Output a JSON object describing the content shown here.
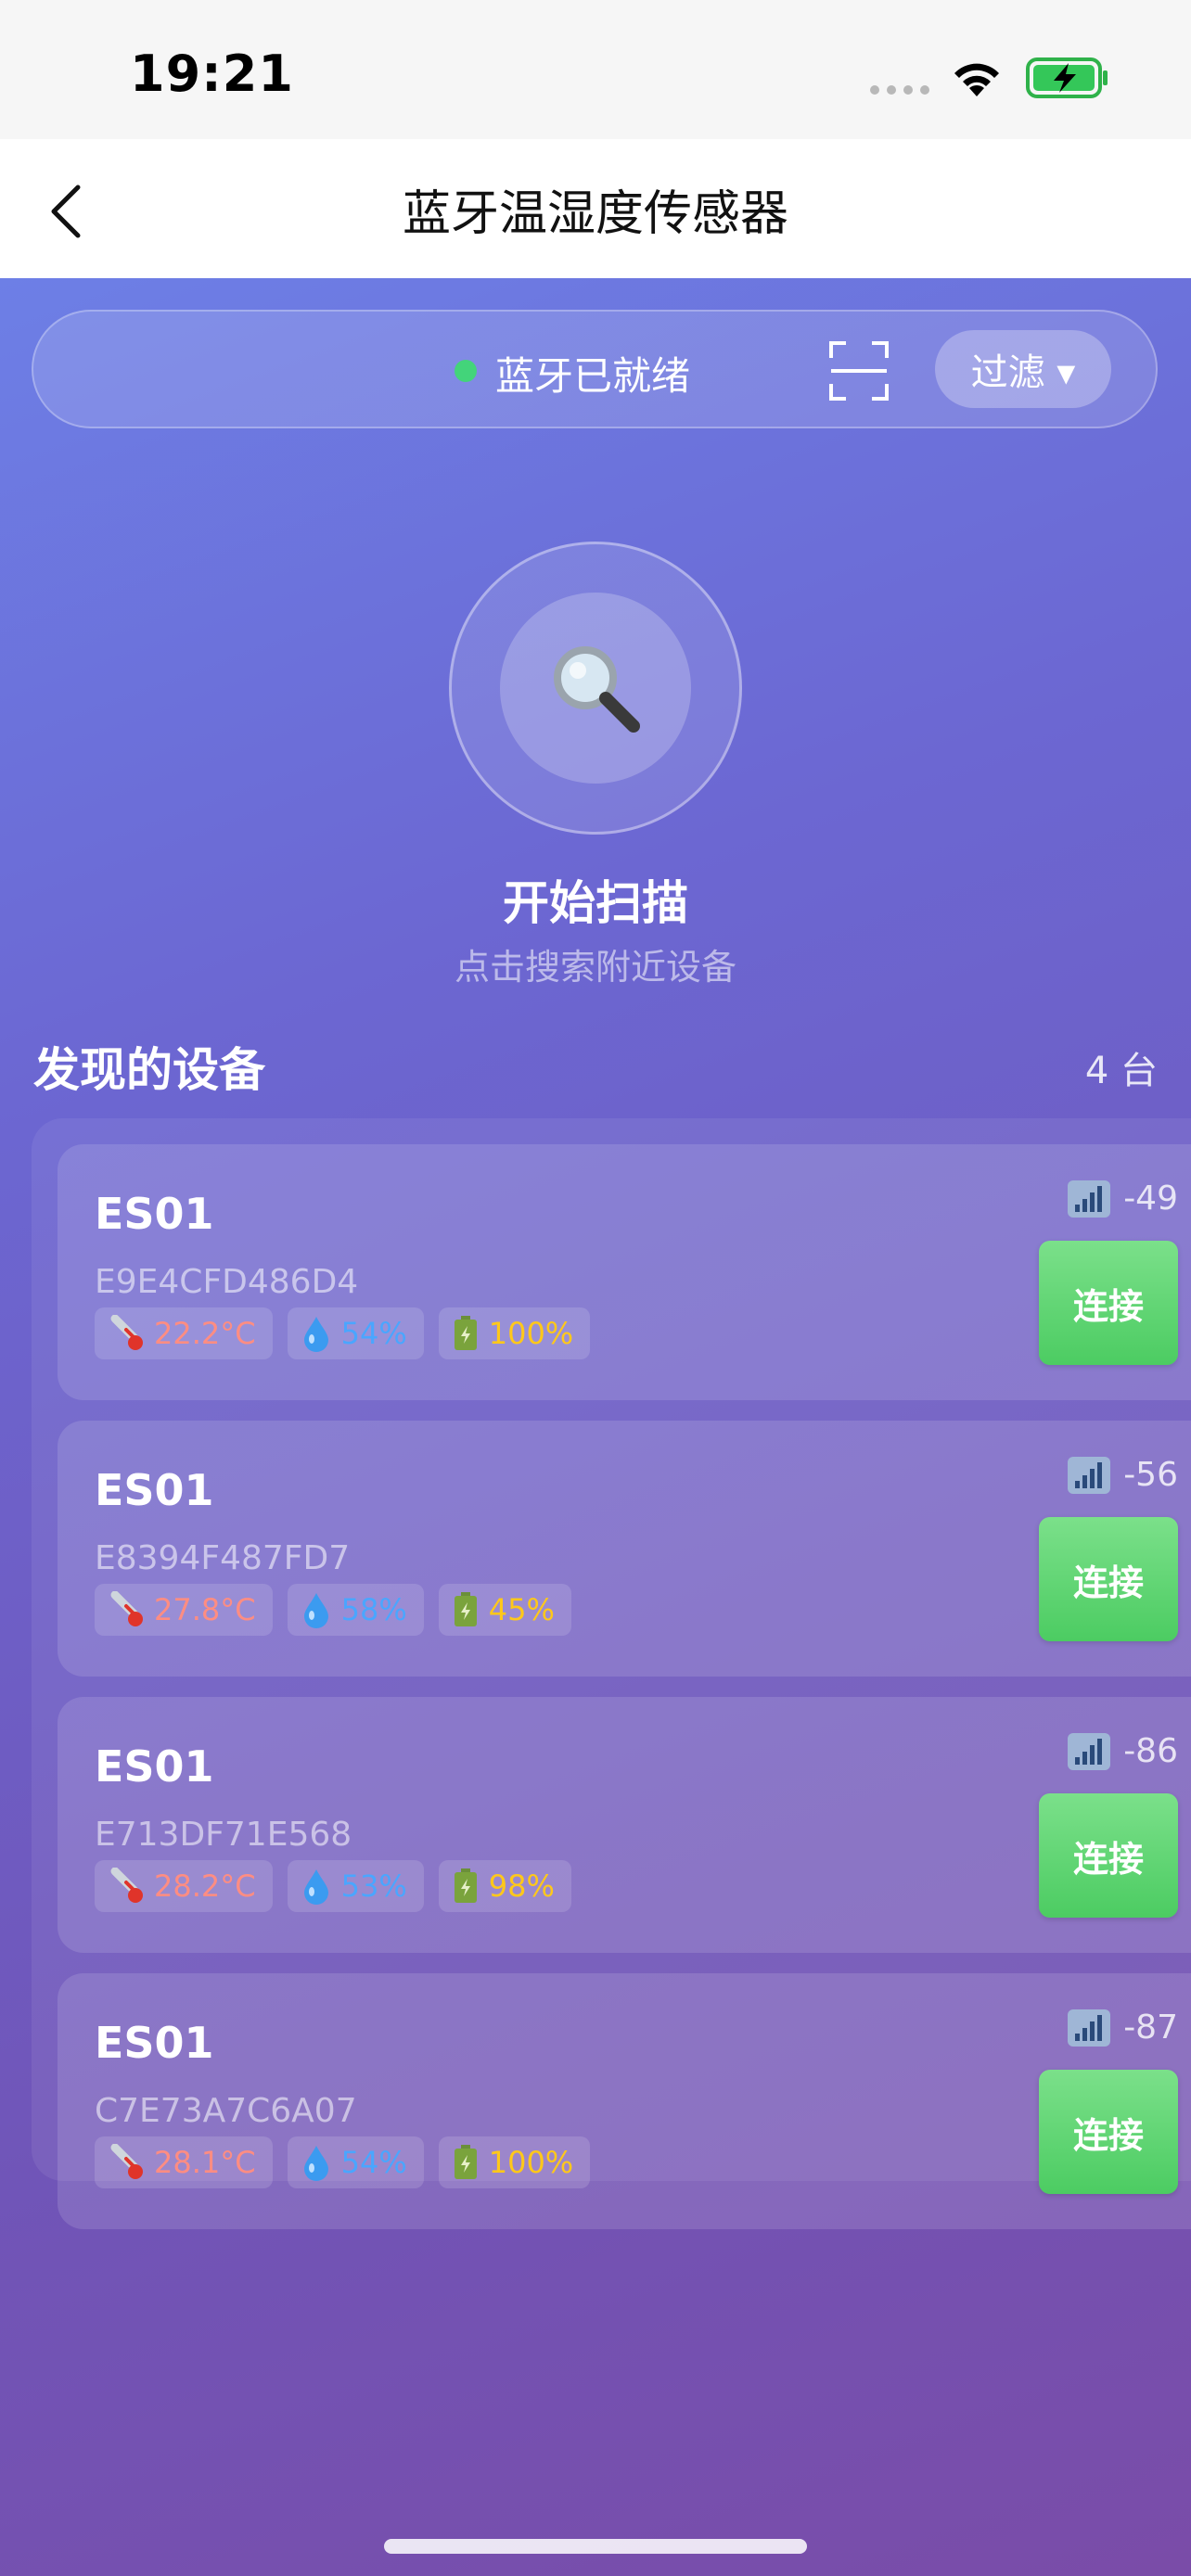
{
  "status_bar": {
    "time": "19:21"
  },
  "nav": {
    "title": "蓝牙温湿度传感器"
  },
  "toolbar": {
    "bluetooth_status": "蓝牙已就绪",
    "filter_label": "过滤 ▾"
  },
  "scan": {
    "title": "开始扫描",
    "subtitle": "点击搜索附近设备"
  },
  "devices_section": {
    "heading": "发现的设备",
    "count": "4 台"
  },
  "devices": [
    {
      "name": "ES01",
      "mac": "E9E4CFD486D4",
      "temperature": "22.2°C",
      "humidity": "54%",
      "battery": "100%",
      "rssi": "-49",
      "connect_label": "连接"
    },
    {
      "name": "ES01",
      "mac": "E8394F487FD7",
      "temperature": "27.8°C",
      "humidity": "58%",
      "battery": "45%",
      "rssi": "-56",
      "connect_label": "连接"
    },
    {
      "name": "ES01",
      "mac": "E713DF71E568",
      "temperature": "28.2°C",
      "humidity": "53%",
      "battery": "98%",
      "rssi": "-86",
      "connect_label": "连接"
    },
    {
      "name": "ES01",
      "mac": "C7E73A7C6A07",
      "temperature": "28.1°C",
      "humidity": "54%",
      "battery": "100%",
      "rssi": "-87",
      "connect_label": "连接"
    }
  ],
  "colors": {
    "status_dot": "#43d47a",
    "connect_button": "#4ccc62",
    "temperature_text": "#ff8d82",
    "humidity_text": "#4aa6ff",
    "battery_text": "#ffc81a"
  },
  "icons": {
    "back": "chevron-left-icon",
    "scan_frame": "scan-frame-icon",
    "scan": "magnifier-icon",
    "temperature": "thermometer-icon",
    "humidity": "droplet-icon",
    "battery": "battery-icon",
    "signal": "signal-bars-icon"
  }
}
